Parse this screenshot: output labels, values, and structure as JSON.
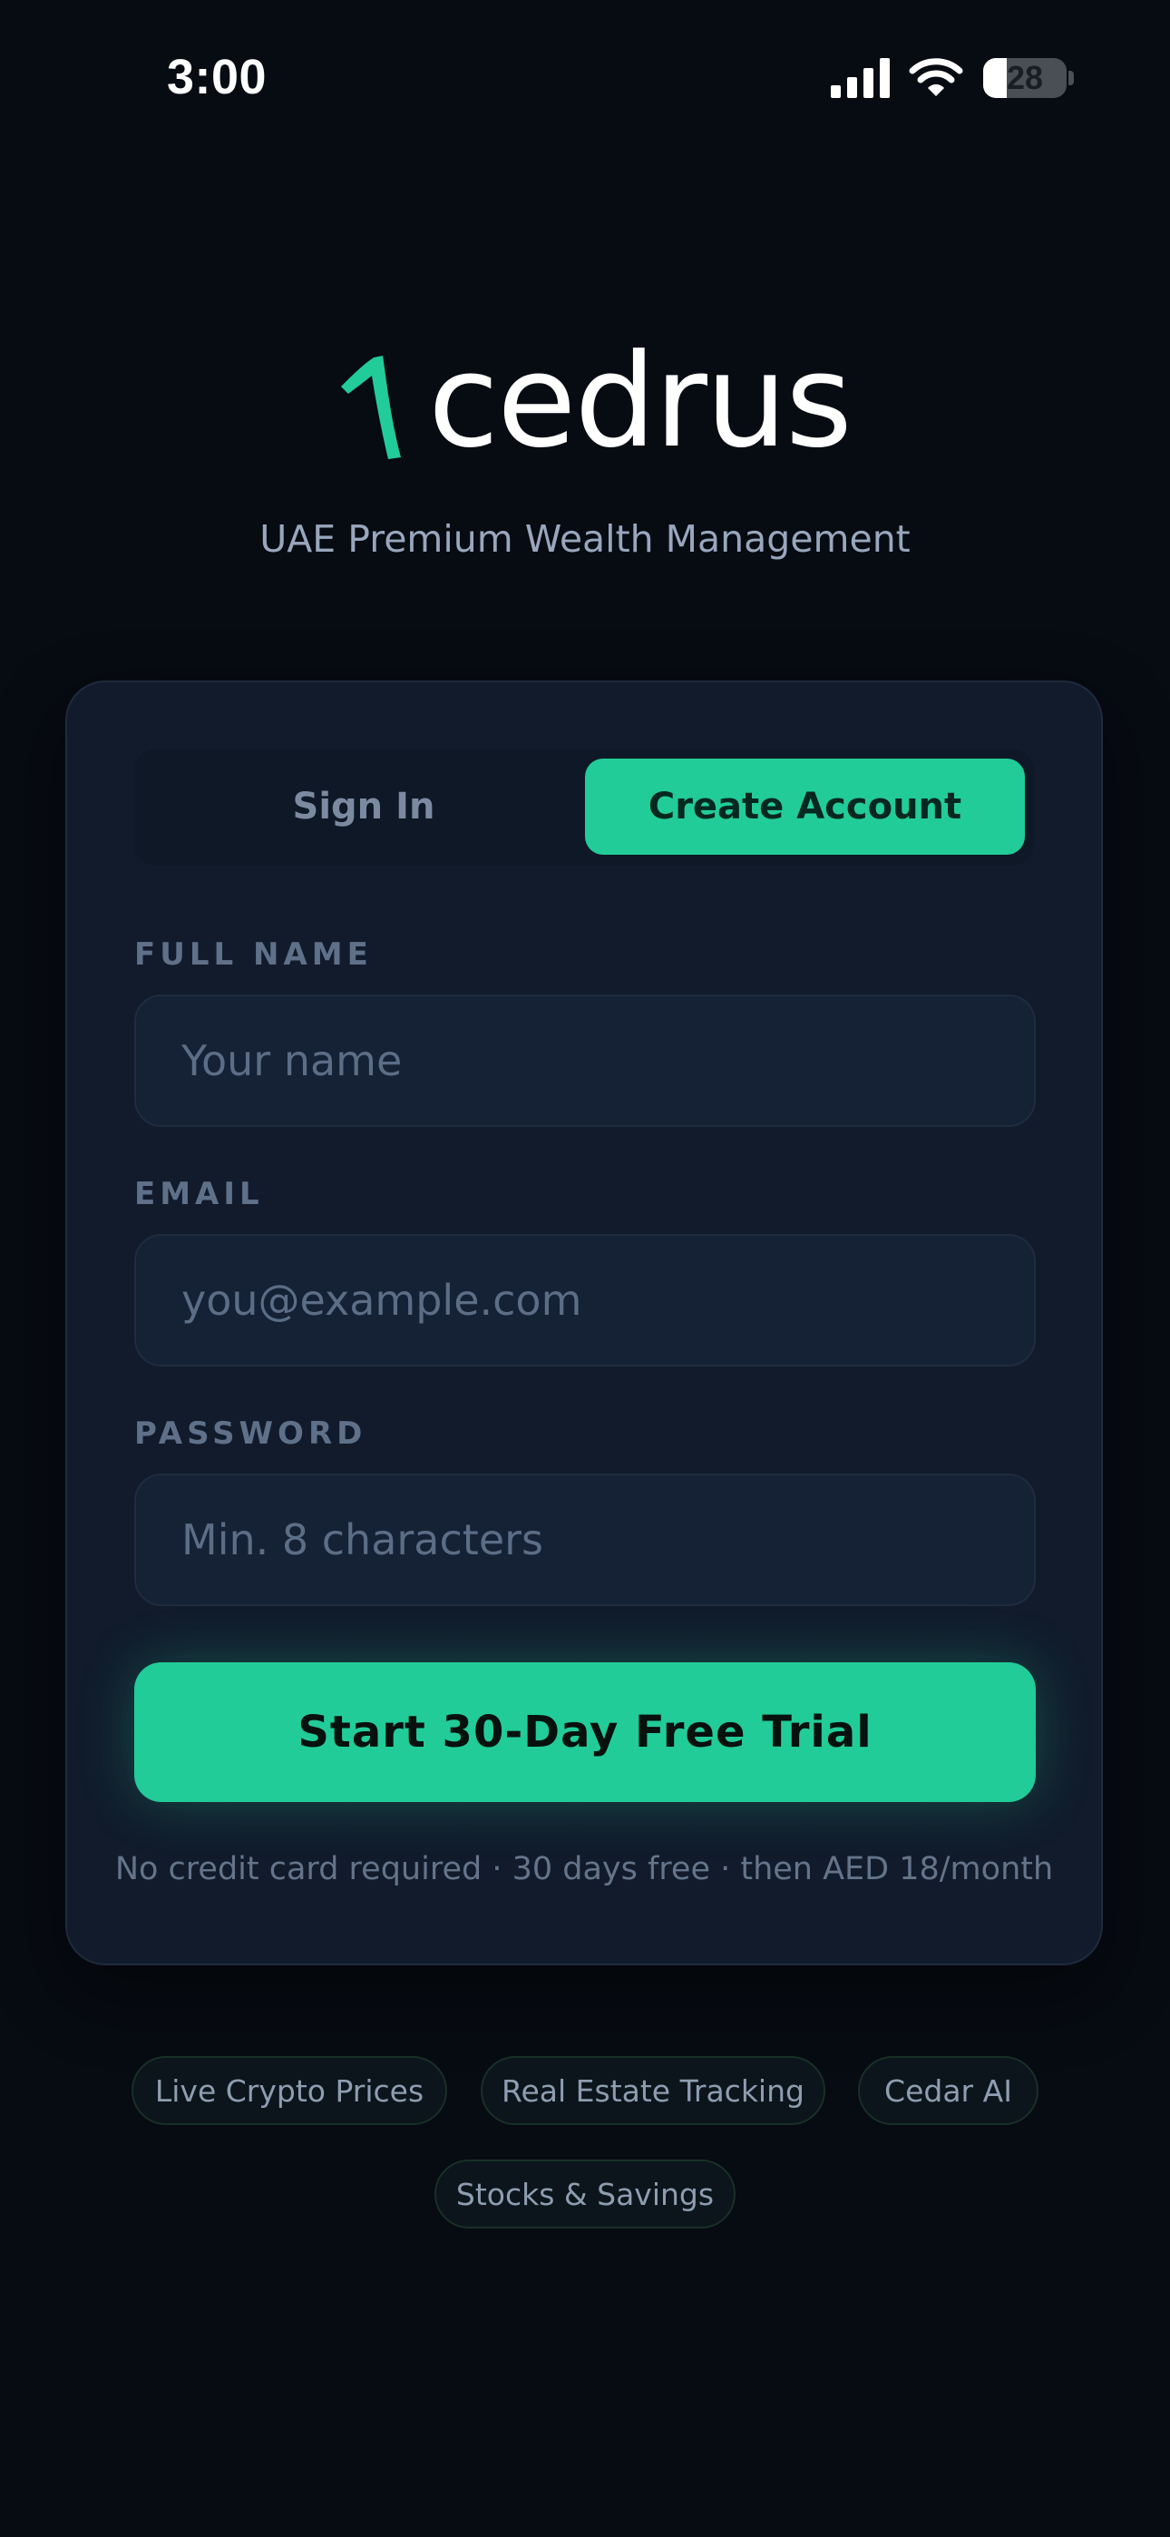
{
  "status_bar": {
    "time": "3:00",
    "battery_level": "28",
    "battery_fraction": 0.28
  },
  "brand": {
    "name": "cedrus",
    "tagline": "UAE Premium Wealth Management",
    "accent_color": "#22cc98"
  },
  "auth_tabs": {
    "sign_in": "Sign In",
    "create_account": "Create Account",
    "active": "create_account"
  },
  "form": {
    "full_name": {
      "label": "FULL NAME",
      "placeholder": "Your name",
      "value": ""
    },
    "email": {
      "label": "EMAIL",
      "placeholder": "you@example.com",
      "value": ""
    },
    "password": {
      "label": "PASSWORD",
      "placeholder": "Min. 8 characters",
      "value": ""
    },
    "submit_label": "Start 30-Day Free Trial",
    "fineprint": "No credit card required · 30 days free · then AED 18/month"
  },
  "features": [
    "Live Crypto Prices",
    "Real Estate Tracking",
    "Cedar AI",
    "Stocks & Savings"
  ],
  "icons": {
    "signal": "cellular-signal-icon",
    "wifi": "wifi-icon",
    "battery": "battery-icon",
    "logo": "cedar-branch-logo"
  }
}
